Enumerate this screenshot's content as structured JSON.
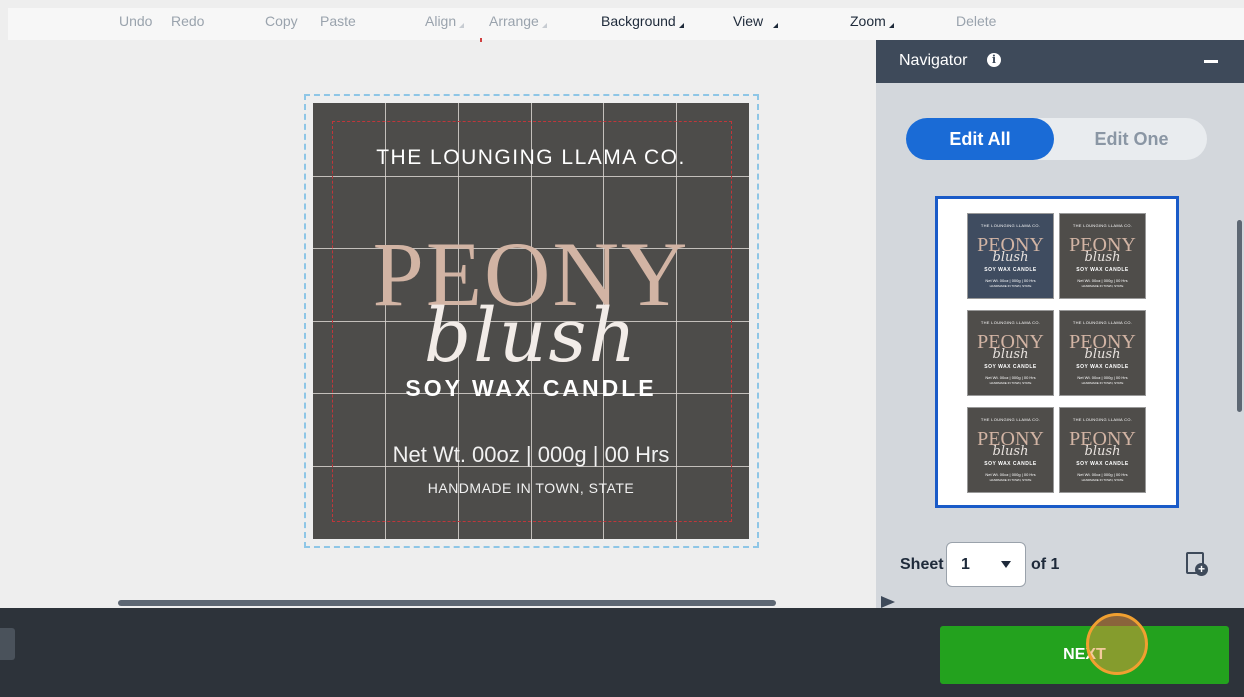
{
  "toolbar": {
    "items": [
      {
        "label": "Undo",
        "state": "disabled"
      },
      {
        "label": "Redo",
        "state": "disabled"
      },
      {
        "label": "Copy",
        "state": "disabled"
      },
      {
        "label": "Paste",
        "state": "disabled"
      },
      {
        "label": "Align",
        "state": "disabled"
      },
      {
        "label": "Arrange",
        "state": "disabled"
      },
      {
        "label": "Background",
        "state": "active"
      },
      {
        "label": "View",
        "state": "active"
      },
      {
        "label": "Zoom",
        "state": "active"
      },
      {
        "label": "Delete",
        "state": "disabled"
      }
    ]
  },
  "label": {
    "brand": "THE LOUNGING LLAMA CO.",
    "title": "PEONY",
    "script": "blush",
    "product": "SOY WAX CANDLE",
    "weight": "Net Wt. 00oz | 000g | 00 Hrs",
    "location": "HANDMADE IN TOWN, STATE",
    "background_color": "#4d4c4a",
    "title_color": "#d2b4a4"
  },
  "navigator": {
    "title": "Navigator",
    "edit_all": "Edit All",
    "edit_one": "Edit One",
    "thumbnail": {
      "brand": "THE LOUNGING LLAMA CO.",
      "title": "PEONY",
      "script": "blush",
      "product": "SOY WAX CANDLE",
      "weight": "Net Wt. 00oz | 000g | 00 Hrs",
      "location": "HANDMADE IN TOWN, STATE",
      "count": 6
    },
    "sheet_label": "Sheet",
    "sheet_value": "1",
    "sheet_of": "of 1"
  },
  "footer": {
    "next_label": "NEXT",
    "next_color": "#23a21e"
  },
  "icons": [
    "info-icon",
    "minimize-icon",
    "chevron-down-icon",
    "add-sheet-icon"
  ]
}
